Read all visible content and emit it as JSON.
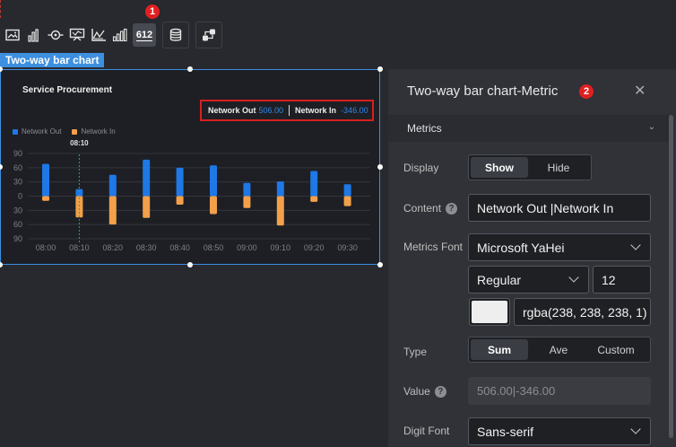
{
  "markers": {
    "toolbar": "1",
    "panel": "2"
  },
  "toolbar": {
    "items": [
      {
        "name": "image-icon"
      },
      {
        "name": "bar-chart-icon"
      },
      {
        "name": "target-icon"
      },
      {
        "name": "screen-icon"
      },
      {
        "name": "line-axis-icon"
      },
      {
        "name": "bar-grow-icon"
      },
      {
        "name": "digit-icon",
        "label": "612"
      }
    ],
    "group_icons": [
      "database-icon",
      "link-flow-icon"
    ]
  },
  "component": {
    "tag": "Two-way bar chart"
  },
  "chart_data": {
    "type": "bar",
    "title": "Service Procurement",
    "categories": [
      "08:00",
      "08:10",
      "08:20",
      "08:30",
      "08:40",
      "08:50",
      "09:00",
      "09:10",
      "09:20",
      "09:30"
    ],
    "series": [
      {
        "name": "Network Out",
        "color": "#1e78e6",
        "values": [
          68,
          15,
          45,
          77,
          60,
          65,
          28,
          31,
          53,
          25
        ]
      },
      {
        "name": "Network In",
        "color": "#f2a04a",
        "values": [
          -10,
          -45,
          -60,
          -46,
          -18,
          -38,
          -25,
          -62,
          -12,
          -21
        ]
      }
    ],
    "yticks": [
      "90",
      "60",
      "30",
      "0",
      "30",
      "60",
      "90"
    ],
    "ylim": [
      -90,
      90
    ],
    "hover_label": "08:10",
    "grid": true,
    "legend": "top-left",
    "metrics": {
      "out_label": "Network Out",
      "out_value": "506.00",
      "in_label": "Network In",
      "in_value": "-346.00"
    }
  },
  "panel": {
    "title": "Two-way bar chart-Metric",
    "close_icon": "close-icon",
    "section": "Metrics",
    "display": {
      "label": "Display",
      "options": [
        "Show",
        "Hide"
      ],
      "selected": "Show"
    },
    "content": {
      "label": "Content",
      "value": "Network Out |Network In"
    },
    "metrics_font": {
      "label": "Metrics Font",
      "family": "Microsoft YaHei",
      "weight": "Regular",
      "size": "12",
      "color": "rgba(238, 238, 238, 1)"
    },
    "type": {
      "label": "Type",
      "options": [
        "Sum",
        "Ave",
        "Custom"
      ],
      "selected": "Sum"
    },
    "value": {
      "label": "Value",
      "value": "506.00|-346.00"
    },
    "digit_font": {
      "label": "Digit Font",
      "family": "Sans-serif"
    }
  }
}
